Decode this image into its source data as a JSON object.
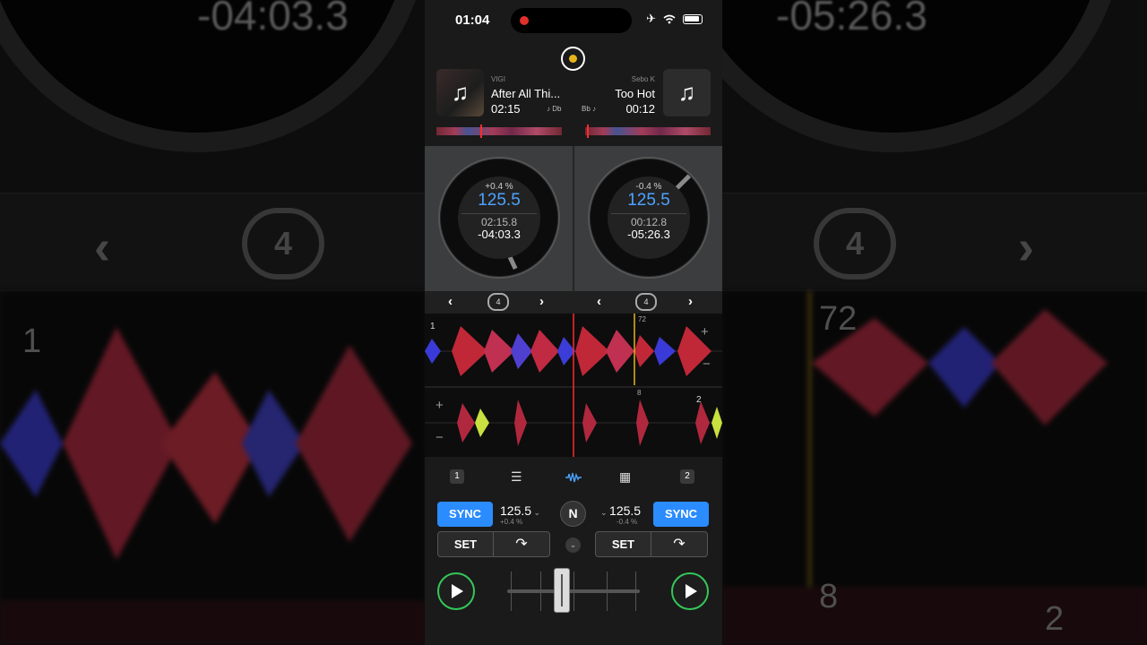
{
  "status_bar": {
    "time": "01:04"
  },
  "background": {
    "left_remaining": "-04:03.3",
    "right_remaining": "-05:26.3",
    "loop_count": "4",
    "wave_labels": {
      "left_cue": "1",
      "beat_72": "72",
      "beat_8": "8",
      "right_cue": "2"
    }
  },
  "deck_left": {
    "artist": "VIGI",
    "title": "After All Thi...",
    "elapsed": "02:15",
    "key": "♪ Db",
    "pitch": "+0.4 %",
    "bpm": "125.5",
    "jog_elapsed": "02:15.8",
    "jog_remaining": "-04:03.3",
    "loop_size": "4",
    "sync_label": "SYNC",
    "set_label": "SET",
    "bpm_display": "125.5",
    "pitch_small": "+0.4 %",
    "cue_number": "1",
    "deck_number": "1"
  },
  "deck_right": {
    "artist": "Sebo K",
    "title": "Too Hot",
    "elapsed": "00:12",
    "key": "Bb ♪",
    "pitch": "-0.4 %",
    "bpm": "125.5",
    "jog_elapsed": "00:12.8",
    "jog_remaining": "-05:26.3",
    "loop_size": "4",
    "sync_label": "SYNC",
    "set_label": "SET",
    "bpm_display": "125.5",
    "pitch_small": "-0.4 %",
    "cue_number": "2",
    "deck_number": "2"
  },
  "waveform_labels": {
    "beat_72": "72",
    "beat_8": "8"
  },
  "center": {
    "n_button": "N"
  },
  "icons": {
    "record": "record-icon",
    "music": "music-note-icon",
    "prev": "chevron-left-icon",
    "next": "chevron-right-icon",
    "loop": "loop-icon",
    "mixer": "mixer-icon",
    "waveform": "waveform-icon",
    "pads": "grid-icon",
    "play": "play-icon",
    "cue": "cue-jump-icon"
  },
  "colors": {
    "accent_blue": "#2b8cff",
    "bpm_blue": "#4da2ff",
    "play_green": "#34c759",
    "record_yellow": "#e5b419",
    "playhead_red": "#ff2b2b"
  }
}
